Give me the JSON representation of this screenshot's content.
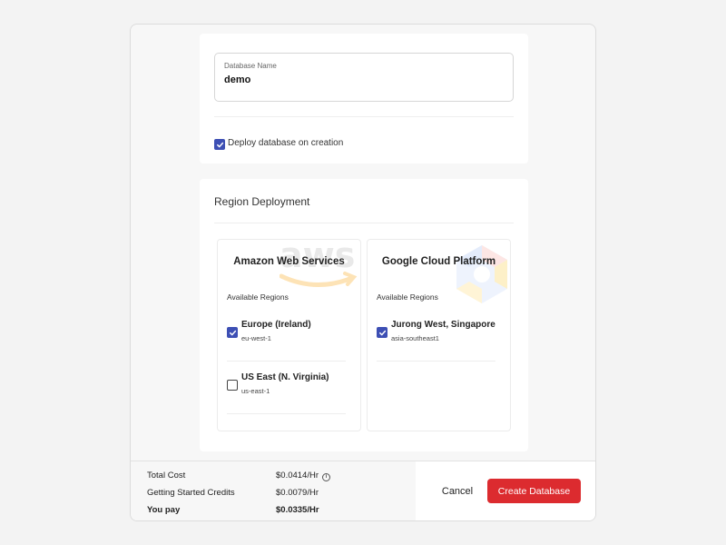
{
  "database_card": {
    "name_label": "Database Name",
    "name_value": "demo",
    "deploy_label": "Deploy database on creation",
    "deploy_checked": true
  },
  "region_card": {
    "title": "Region Deployment",
    "providers": [
      {
        "name": "Amazon Web Services",
        "icon": "aws-logo-watermark",
        "available_label": "Available Regions",
        "regions": [
          {
            "name": "Europe (Ireland)",
            "code": "eu-west-1",
            "checked": true
          },
          {
            "name": "US East (N. Virginia)",
            "code": "us-east-1",
            "checked": false
          }
        ]
      },
      {
        "name": "Google Cloud Platform",
        "icon": "gcp-logo-watermark",
        "available_label": "Available Regions",
        "regions": [
          {
            "name": "Jurong West, Singapore",
            "code": "asia-southeast1",
            "checked": true
          }
        ]
      }
    ]
  },
  "footer": {
    "total_cost_label": "Total Cost",
    "total_cost_value": "$0.0414/Hr",
    "credits_label": "Getting Started Credits",
    "credits_value": "$0.0079/Hr",
    "you_pay_label": "You pay",
    "you_pay_value": "$0.0335/Hr",
    "cancel_label": "Cancel",
    "create_label": "Create Database"
  },
  "colors": {
    "accent": "#3d4fb4",
    "primary_button": "#dc2b2f",
    "aws_orange": "#ff9900"
  }
}
